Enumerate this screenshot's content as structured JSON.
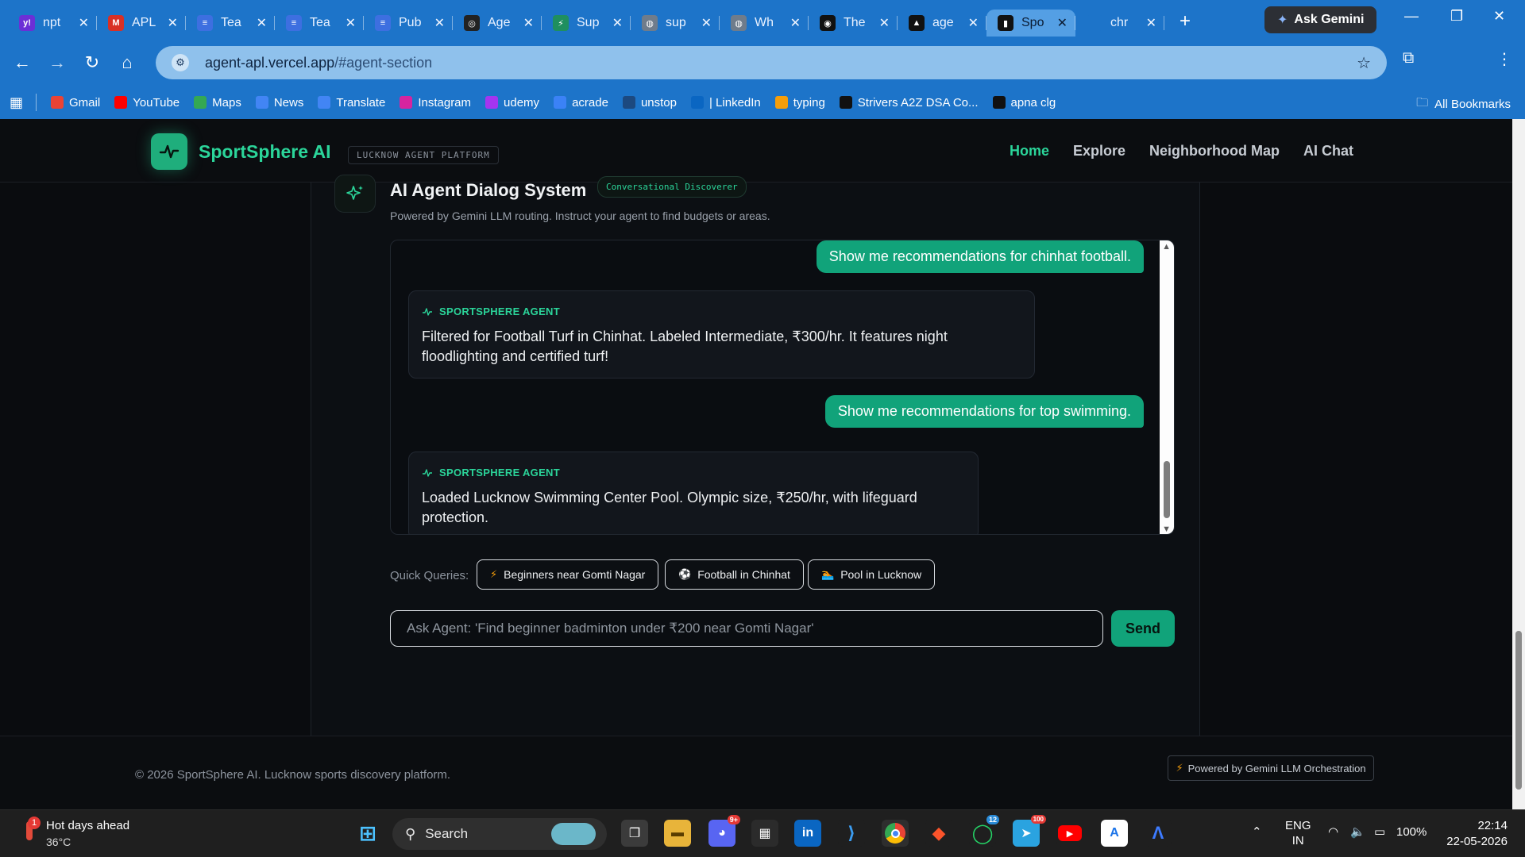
{
  "browser": {
    "tabs": [
      {
        "label": "npt",
        "color": "#6b2fd6",
        "glyph": "y!"
      },
      {
        "label": "APL",
        "color": "#d93025",
        "glyph": "M"
      },
      {
        "label": "Tea",
        "color": "#3d6fe0",
        "glyph": "≡"
      },
      {
        "label": "Tea",
        "color": "#3d6fe0",
        "glyph": "≡"
      },
      {
        "label": "Pub",
        "color": "#3d6fe0",
        "glyph": "≡"
      },
      {
        "label": "Age",
        "color": "#222222",
        "glyph": "◎"
      },
      {
        "label": "Sup",
        "color": "#1f8f5f",
        "glyph": "⚡"
      },
      {
        "label": "sup",
        "color": "#6f7c8b",
        "glyph": "◍"
      },
      {
        "label": "Wh",
        "color": "#6f7c8b",
        "glyph": "◍"
      },
      {
        "label": "The",
        "color": "#111111",
        "glyph": "◉"
      },
      {
        "label": "age",
        "color": "#111111",
        "glyph": "▲"
      },
      {
        "label": "Spo",
        "color": "#111111",
        "glyph": "▮",
        "active": true
      },
      {
        "label": "chr",
        "color": "#1d74c9",
        "glyph": ""
      }
    ],
    "new_tab": "+",
    "ask_gemini": "Ask Gemini",
    "url_host": "agent-apl.vercel.app",
    "url_path": "/#agent-section",
    "bookmarks": [
      {
        "label": "Gmail",
        "color": "#ea4335"
      },
      {
        "label": "YouTube",
        "color": "#ff0000"
      },
      {
        "label": "Maps",
        "color": "#34a853"
      },
      {
        "label": "News",
        "color": "#4285f4"
      },
      {
        "label": "Translate",
        "color": "#4285f4"
      },
      {
        "label": "Instagram",
        "color": "#d6249f"
      },
      {
        "label": "udemy",
        "color": "#a435f0"
      },
      {
        "label": "acrade",
        "color": "#3b82f6"
      },
      {
        "label": "unstop",
        "color": "#1c4980"
      },
      {
        "label": "| LinkedIn",
        "color": "#0a66c2"
      },
      {
        "label": "typing",
        "color": "#f59e0b"
      },
      {
        "label": "Strivers A2Z DSA Co...",
        "color": "#111111"
      },
      {
        "label": "apna clg",
        "color": "#111111"
      }
    ],
    "all_bookmarks": "All Bookmarks"
  },
  "site": {
    "brand": "SportSphere AI",
    "platform_badge": "LUCKNOW AGENT PLATFORM",
    "nav": [
      "Home",
      "Explore",
      "Neighborhood Map",
      "AI Chat"
    ],
    "active_nav": "Home"
  },
  "agent": {
    "title": "AI Agent Dialog System",
    "badge": "Conversational Discoverer",
    "subtitle": "Powered by Gemini LLM routing. Instruct your agent to find budgets or areas.",
    "sender_label": "SPORTSPHERE AGENT",
    "messages": [
      {
        "role": "user",
        "text": "Show me recommendations for chinhat football."
      },
      {
        "role": "agent",
        "text": "Filtered for Football Turf in Chinhat. Labeled Intermediate, ₹300/hr. It features night floodlighting and certified turf!"
      },
      {
        "role": "user",
        "text": "Show me recommendations for top swimming."
      },
      {
        "role": "agent",
        "text": "Loaded Lucknow Swimming Center Pool. Olympic size, ₹250/hr, with lifeguard protection."
      }
    ],
    "quick_label": "Quick Queries:",
    "quick_queries": [
      {
        "icon": "⚡",
        "label": "Beginners near Gomti Nagar"
      },
      {
        "icon": "⚽",
        "label": "Football in Chinhat"
      },
      {
        "icon": "🏊",
        "label": "Pool in Lucknow"
      }
    ],
    "input_placeholder": "Ask Agent: 'Find beginner badminton under ₹200 near Gomti Nagar'",
    "send_label": "Send"
  },
  "footer": {
    "copyright": "© 2026 SportSphere AI. Lucknow sports discovery platform.",
    "powered": "Powered by Gemini LLM Orchestration"
  },
  "taskbar": {
    "weather_title": "Hot days ahead",
    "weather_temp": "36°C",
    "weather_alert": "1",
    "search": "Search",
    "discord_badge": "9+",
    "whatsapp_badge": "12",
    "telegram_badge": "100",
    "lang_1": "ENG",
    "lang_2": "IN",
    "battery": "100%",
    "time": "22:14",
    "date": "22-05-2026"
  },
  "colors": {
    "accent": "#2bd59a",
    "accent_dark": "#11a37a",
    "page_bg": "#0a0c0f",
    "chrome_blue": "#1d74c9"
  }
}
